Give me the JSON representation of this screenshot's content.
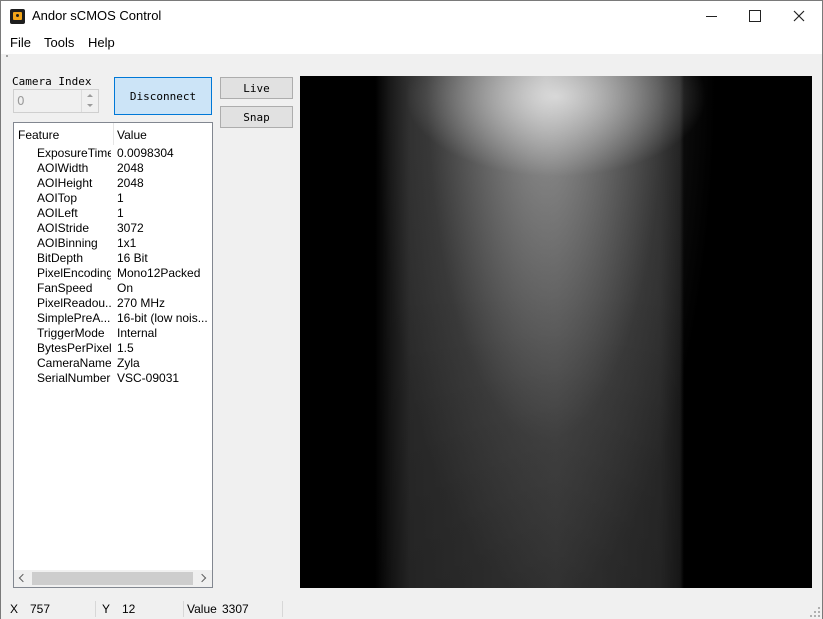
{
  "window": {
    "title": "Andor sCMOS Control"
  },
  "menu": {
    "file": "File",
    "tools": "Tools",
    "help": "Help"
  },
  "camera": {
    "index_label": "Camera Index",
    "index_value": "0"
  },
  "buttons": {
    "disconnect": "Disconnect",
    "live": "Live",
    "snap": "Snap"
  },
  "properties": {
    "header_feature": "Feature",
    "header_value": "Value",
    "rows": [
      {
        "feature": "ExposureTime",
        "value": "0.0098304"
      },
      {
        "feature": "AOIWidth",
        "value": "2048"
      },
      {
        "feature": "AOIHeight",
        "value": "2048"
      },
      {
        "feature": "AOITop",
        "value": "1"
      },
      {
        "feature": "AOILeft",
        "value": "1"
      },
      {
        "feature": "AOIStride",
        "value": "3072"
      },
      {
        "feature": "AOIBinning",
        "value": "1x1"
      },
      {
        "feature": "BitDepth",
        "value": "16 Bit"
      },
      {
        "feature": "PixelEncoding",
        "value": "Mono12Packed"
      },
      {
        "feature": "FanSpeed",
        "value": "On"
      },
      {
        "feature": "PixelReadou...",
        "value": "270 MHz"
      },
      {
        "feature": "SimplePreA...",
        "value": "16-bit (low nois..."
      },
      {
        "feature": "TriggerMode",
        "value": "Internal"
      },
      {
        "feature": "BytesPerPixel",
        "value": "1.5"
      },
      {
        "feature": "CameraName",
        "value": "Zyla"
      },
      {
        "feature": "SerialNumber",
        "value": "VSC-09031"
      }
    ]
  },
  "status": {
    "x_label": "X",
    "x_value": "757",
    "y_label": "Y",
    "y_value": "12",
    "value_label": "Value",
    "value_value": "3307"
  },
  "colors": {
    "accent": "#0078d7",
    "button_selected_bg": "#cce4f7",
    "window_bg": "#f0f0f0"
  },
  "icons": {
    "app": "camera-icon",
    "minimize": "minimize-icon",
    "maximize": "maximize-icon",
    "close": "close-icon"
  }
}
